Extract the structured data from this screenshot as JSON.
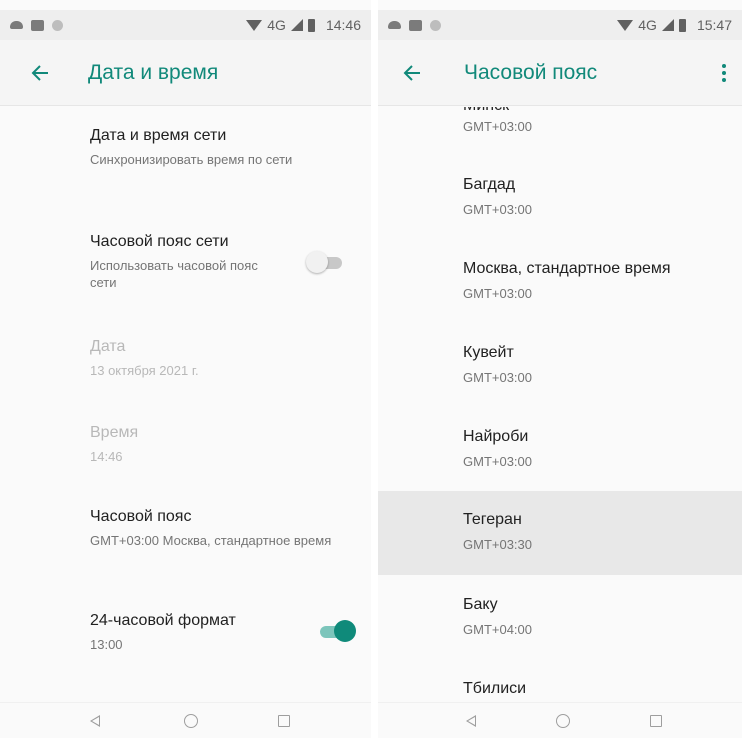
{
  "left": {
    "status_bar": {
      "time": "14:46",
      "network": "4G"
    },
    "app_bar": {
      "title": "Дата и время"
    },
    "settings": [
      {
        "title": "Дата и время сети",
        "summary": "Синхронизировать время по сети"
      },
      {
        "title": "Часовой пояс сети",
        "summary": "Использовать часовой пояс сети",
        "switch": "off"
      },
      {
        "title": "Дата",
        "summary": "13 октября 2021 г.",
        "disabled": true
      },
      {
        "title": "Время",
        "summary": "14:46",
        "disabled": true
      },
      {
        "title": "Часовой пояс",
        "summary": "GMT+03:00 Москва, стандартное время"
      },
      {
        "title": "24-часовой формат",
        "summary": "13:00",
        "switch": "on"
      }
    ]
  },
  "right": {
    "status_bar": {
      "time": "15:47",
      "network": "4G"
    },
    "app_bar": {
      "title": "Часовой пояс"
    },
    "timezones": [
      {
        "name": "Минск",
        "offset": "GMT+03:00"
      },
      {
        "name": "Багдад",
        "offset": "GMT+03:00"
      },
      {
        "name": "Москва, стандартное время",
        "offset": "GMT+03:00"
      },
      {
        "name": "Кувейт",
        "offset": "GMT+03:00"
      },
      {
        "name": "Найроби",
        "offset": "GMT+03:00"
      },
      {
        "name": "Тегеран",
        "offset": "GMT+03:30",
        "highlighted": true
      },
      {
        "name": "Баку",
        "offset": "GMT+04:00"
      },
      {
        "name": "Тбилиси",
        "offset": ""
      }
    ]
  },
  "colors": {
    "accent": "#11897a",
    "switch_on": "#0f8a7a",
    "highlight": "#e8e8e8"
  },
  "icons": {
    "back": "arrow-left-icon",
    "overflow": "more-vert-icon"
  }
}
